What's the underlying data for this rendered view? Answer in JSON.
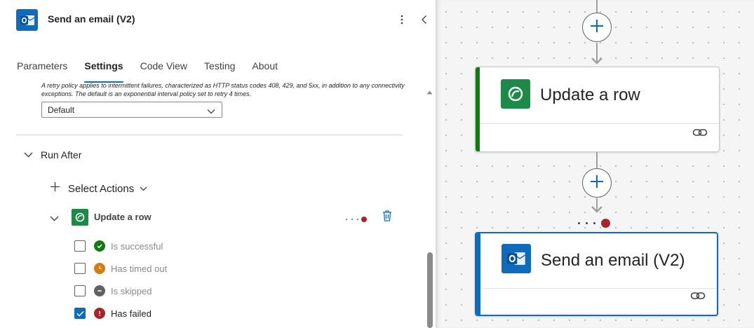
{
  "panel": {
    "title": "Send an email (V2)",
    "tabs": [
      {
        "label": "Parameters",
        "active": false
      },
      {
        "label": "Settings",
        "active": true
      },
      {
        "label": "Code View",
        "active": false
      },
      {
        "label": "Testing",
        "active": false
      },
      {
        "label": "About",
        "active": false
      }
    ],
    "retry_policy": {
      "description": "A retry policy applies to intermittent failures, characterized as HTTP status codes 408, 429, and 5xx, in addition to any connectivity exceptions. The default is an exponential interval policy set to retry 4 times.",
      "value": "Default"
    },
    "run_after": {
      "label": "Run After",
      "select_actions_label": "Select Actions",
      "action": {
        "label": "Update a row",
        "statuses": [
          {
            "label": "Is successful",
            "checked": false,
            "color": "#107c10"
          },
          {
            "label": "Has timed out",
            "checked": false,
            "color": "#d97a0f"
          },
          {
            "label": "Is skipped",
            "checked": false,
            "color": "#616161"
          },
          {
            "label": "Has failed",
            "checked": true,
            "color": "#a4262c"
          }
        ]
      }
    }
  },
  "canvas": {
    "cards": [
      {
        "title": "Update a row",
        "accent": "#107c10",
        "icon": "dataverse-icon",
        "selected": false
      },
      {
        "title": "Send an email (V2)",
        "accent": "#0f6cbd",
        "icon": "outlook-icon",
        "selected": true
      }
    ]
  },
  "colors": {
    "accent": "#0f6cbd",
    "dataverse": "#1e8a4a",
    "failed": "#a4262c"
  }
}
